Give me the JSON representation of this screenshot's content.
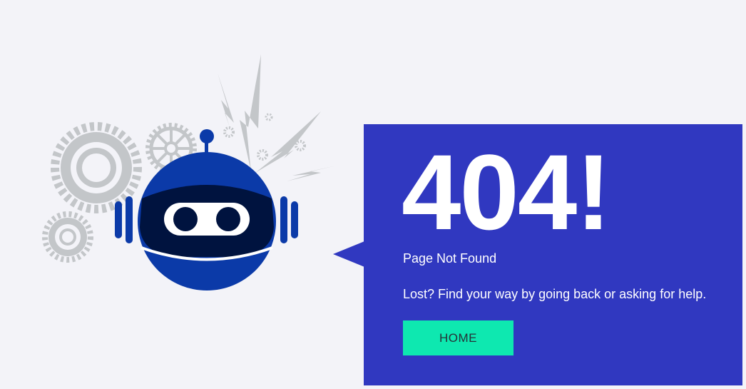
{
  "error": {
    "code": "404!",
    "title": "Page Not Found",
    "message": "Lost? Find your way by going back or asking for help.",
    "home_label": "HOME"
  },
  "colors": {
    "background": "#f3f3f8",
    "panel": "#3038c0",
    "button": "#0ee8b0",
    "robot_blue": "#0b3aa8",
    "robot_visor": "#00133f",
    "gear_gray": "#c3c6c9"
  },
  "illustration": {
    "subject": "robot-with-gears-and-lightning"
  }
}
